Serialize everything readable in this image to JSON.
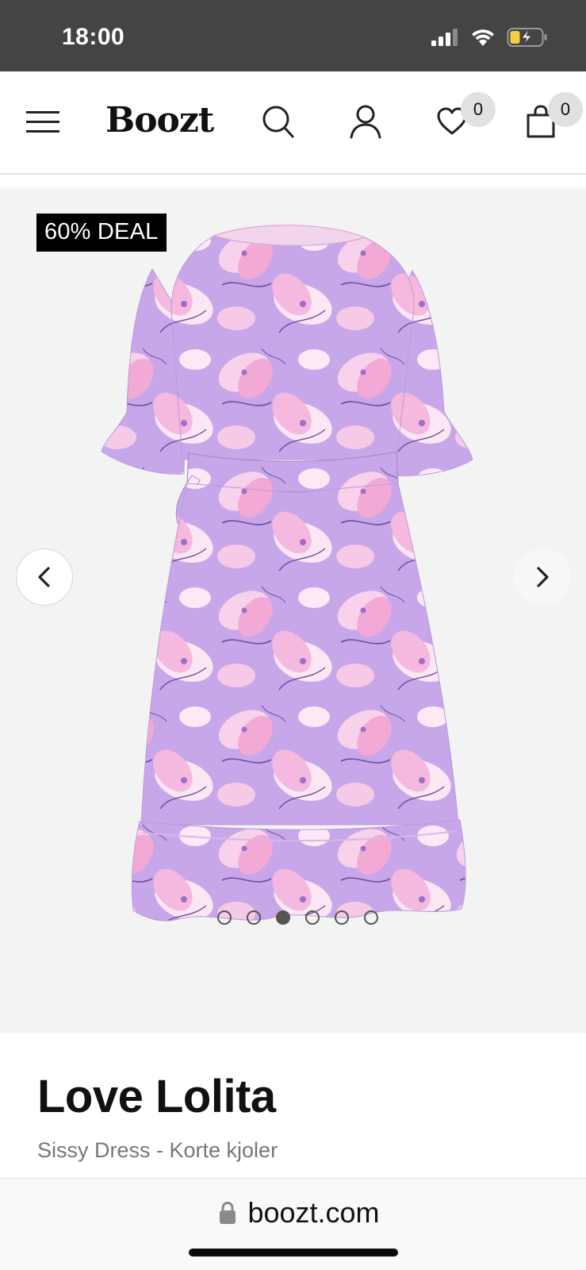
{
  "status_bar": {
    "time": "18:00",
    "icons": [
      "signal-icon",
      "wifi-icon",
      "battery-charging-icon"
    ]
  },
  "header": {
    "logo": "Boozt",
    "wishlist_count": "0",
    "cart_count": "0",
    "icons": [
      "hamburger-menu-icon",
      "search-icon",
      "user-icon",
      "heart-icon",
      "shopping-bag-icon"
    ]
  },
  "gallery": {
    "deal_badge": "60% DEAL",
    "image_count": 6,
    "active_index": 2,
    "prev_icon": "chevron-left-icon",
    "next_icon": "chevron-right-icon"
  },
  "product": {
    "brand": "Love Lolita",
    "subtitle": "Sissy Dress - Korte kjoler"
  },
  "browser": {
    "url": "boozt.com",
    "lock_icon": "lock-icon"
  },
  "colors": {
    "status_bar_bg": "#444444",
    "gallery_bg": "#f3f3f3",
    "badge_bg": "#000000",
    "dress_lavender": "#c6a6e8",
    "dress_pink": "#f5b6dd"
  }
}
